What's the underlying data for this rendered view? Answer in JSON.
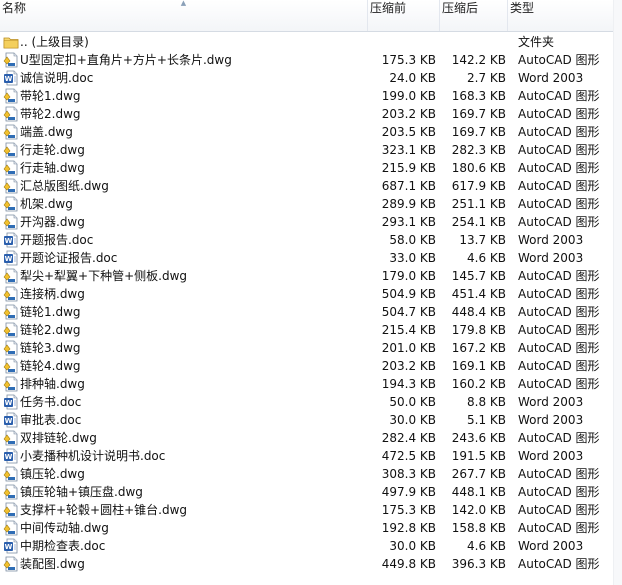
{
  "columns": {
    "name": "名称",
    "original": "压缩前",
    "compressed": "压缩后",
    "type": "类型"
  },
  "rows": [
    {
      "name": ".. (上级目录)",
      "original": "",
      "compressed": "",
      "type": "文件夹",
      "icon": "folder-icon"
    },
    {
      "name": "U型固定扣+直角片+方片+长条片.dwg",
      "original": "175.3 KB",
      "compressed": "142.2 KB",
      "type": "AutoCAD 图形",
      "icon": "dwg-file-icon"
    },
    {
      "name": "诚信说明.doc",
      "original": "24.0 KB",
      "compressed": "2.7 KB",
      "type": "Word 2003",
      "icon": "doc-file-icon"
    },
    {
      "name": "带轮1.dwg",
      "original": "199.0 KB",
      "compressed": "168.3 KB",
      "type": "AutoCAD 图形",
      "icon": "dwg-file-icon"
    },
    {
      "name": "带轮2.dwg",
      "original": "203.2 KB",
      "compressed": "169.7 KB",
      "type": "AutoCAD 图形",
      "icon": "dwg-file-icon"
    },
    {
      "name": "端盖.dwg",
      "original": "203.5 KB",
      "compressed": "169.7 KB",
      "type": "AutoCAD 图形",
      "icon": "dwg-file-icon"
    },
    {
      "name": "行走轮.dwg",
      "original": "323.1 KB",
      "compressed": "282.3 KB",
      "type": "AutoCAD 图形",
      "icon": "dwg-file-icon"
    },
    {
      "name": "行走轴.dwg",
      "original": "215.9 KB",
      "compressed": "180.6 KB",
      "type": "AutoCAD 图形",
      "icon": "dwg-file-icon"
    },
    {
      "name": "汇总版图纸.dwg",
      "original": "687.1 KB",
      "compressed": "617.9 KB",
      "type": "AutoCAD 图形",
      "icon": "dwg-file-icon"
    },
    {
      "name": "机架.dwg",
      "original": "289.9 KB",
      "compressed": "251.1 KB",
      "type": "AutoCAD 图形",
      "icon": "dwg-file-icon"
    },
    {
      "name": "开沟器.dwg",
      "original": "293.1 KB",
      "compressed": "254.1 KB",
      "type": "AutoCAD 图形",
      "icon": "dwg-file-icon"
    },
    {
      "name": "开题报告.doc",
      "original": "58.0 KB",
      "compressed": "13.7 KB",
      "type": "Word 2003",
      "icon": "doc-file-icon"
    },
    {
      "name": "开题论证报告.doc",
      "original": "33.0 KB",
      "compressed": "4.6 KB",
      "type": "Word 2003",
      "icon": "doc-file-icon"
    },
    {
      "name": "犁尖+犁翼+下种管+侧板.dwg",
      "original": "179.0 KB",
      "compressed": "145.7 KB",
      "type": "AutoCAD 图形",
      "icon": "dwg-file-icon"
    },
    {
      "name": "连接柄.dwg",
      "original": "504.9 KB",
      "compressed": "451.4 KB",
      "type": "AutoCAD 图形",
      "icon": "dwg-file-icon"
    },
    {
      "name": "链轮1.dwg",
      "original": "504.7 KB",
      "compressed": "448.4 KB",
      "type": "AutoCAD 图形",
      "icon": "dwg-file-icon"
    },
    {
      "name": "链轮2.dwg",
      "original": "215.4 KB",
      "compressed": "179.8 KB",
      "type": "AutoCAD 图形",
      "icon": "dwg-file-icon"
    },
    {
      "name": "链轮3.dwg",
      "original": "201.0 KB",
      "compressed": "167.2 KB",
      "type": "AutoCAD 图形",
      "icon": "dwg-file-icon"
    },
    {
      "name": "链轮4.dwg",
      "original": "203.2 KB",
      "compressed": "169.1 KB",
      "type": "AutoCAD 图形",
      "icon": "dwg-file-icon"
    },
    {
      "name": "排种轴.dwg",
      "original": "194.3 KB",
      "compressed": "160.2 KB",
      "type": "AutoCAD 图形",
      "icon": "dwg-file-icon"
    },
    {
      "name": "任务书.doc",
      "original": "50.0 KB",
      "compressed": "8.8 KB",
      "type": "Word 2003",
      "icon": "doc-file-icon"
    },
    {
      "name": "审批表.doc",
      "original": "30.0 KB",
      "compressed": "5.1 KB",
      "type": "Word 2003",
      "icon": "doc-file-icon"
    },
    {
      "name": "双排链轮.dwg",
      "original": "282.4 KB",
      "compressed": "243.6 KB",
      "type": "AutoCAD 图形",
      "icon": "dwg-file-icon"
    },
    {
      "name": "小麦播种机设计说明书.doc",
      "original": "472.5 KB",
      "compressed": "191.5 KB",
      "type": "Word 2003",
      "icon": "doc-file-icon"
    },
    {
      "name": "镇压轮.dwg",
      "original": "308.3 KB",
      "compressed": "267.7 KB",
      "type": "AutoCAD 图形",
      "icon": "dwg-file-icon"
    },
    {
      "name": "镇压轮轴+镇压盘.dwg",
      "original": "497.9 KB",
      "compressed": "448.1 KB",
      "type": "AutoCAD 图形",
      "icon": "dwg-file-icon"
    },
    {
      "name": "支撑杆+轮毂+圆柱+锥台.dwg",
      "original": "175.3 KB",
      "compressed": "142.0 KB",
      "type": "AutoCAD 图形",
      "icon": "dwg-file-icon"
    },
    {
      "name": "中间传动轴.dwg",
      "original": "192.8 KB",
      "compressed": "158.8 KB",
      "type": "AutoCAD 图形",
      "icon": "dwg-file-icon"
    },
    {
      "name": "中期检查表.doc",
      "original": "30.0 KB",
      "compressed": "4.6 KB",
      "type": "Word 2003",
      "icon": "doc-file-icon"
    },
    {
      "name": "装配图.dwg",
      "original": "449.8 KB",
      "compressed": "396.3 KB",
      "type": "AutoCAD 图形",
      "icon": "dwg-file-icon"
    }
  ]
}
